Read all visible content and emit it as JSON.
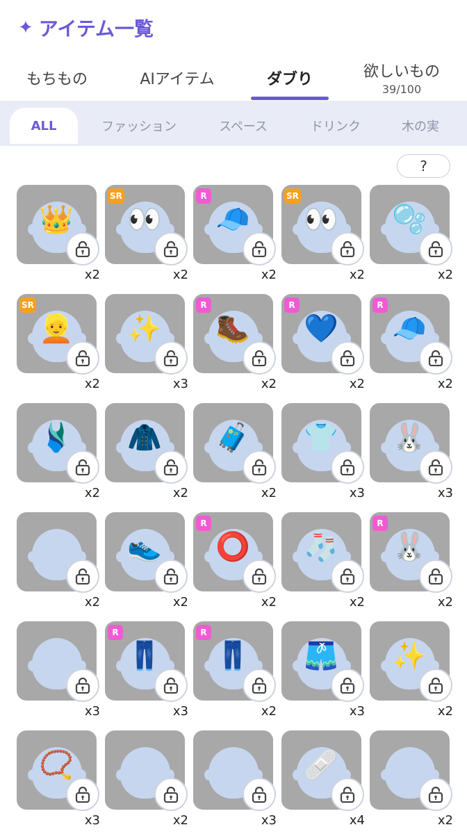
{
  "header": {
    "title_icon": "sparkle-icon",
    "title": "アイテム一覧",
    "accent_color": "#6a5ad8"
  },
  "tabs": [
    {
      "label": "もちもの",
      "active": false
    },
    {
      "label": "AIアイテム",
      "active": false
    },
    {
      "label": "ダブり",
      "active": true
    },
    {
      "label": "欲しいもの",
      "sub": "39/100",
      "active": false
    }
  ],
  "filters": [
    {
      "label": "ALL",
      "active": true
    },
    {
      "label": "ファッション",
      "active": false
    },
    {
      "label": "スペース",
      "active": false
    },
    {
      "label": "ドリンク",
      "active": false
    },
    {
      "label": "木の実",
      "active": false
    }
  ],
  "help_button": "?",
  "items": [
    {
      "badge": "",
      "count": "x2",
      "art": "👑"
    },
    {
      "badge": "SR",
      "count": "x2",
      "art": "👀"
    },
    {
      "badge": "R",
      "count": "x2",
      "art": "🧢"
    },
    {
      "badge": "SR",
      "count": "x2",
      "art": "👀"
    },
    {
      "badge": "",
      "count": "x2",
      "art": "🫧"
    },
    {
      "badge": "SR",
      "count": "x2",
      "art": "👱"
    },
    {
      "badge": "",
      "count": "x3",
      "art": "✨"
    },
    {
      "badge": "R",
      "count": "x2",
      "art": "🥾"
    },
    {
      "badge": "R",
      "count": "x2",
      "art": "💙"
    },
    {
      "badge": "R",
      "count": "x2",
      "art": "🧢"
    },
    {
      "badge": "",
      "count": "x2",
      "art": "🩱"
    },
    {
      "badge": "",
      "count": "x2",
      "art": "🧥"
    },
    {
      "badge": "",
      "count": "x2",
      "art": "🧳"
    },
    {
      "badge": "",
      "count": "x3",
      "art": "👕"
    },
    {
      "badge": "",
      "count": "x3",
      "art": "🐰"
    },
    {
      "badge": "",
      "count": "x2",
      "art": ""
    },
    {
      "badge": "",
      "count": "x2",
      "art": "👟"
    },
    {
      "badge": "R",
      "count": "x2",
      "art": "⭕"
    },
    {
      "badge": "",
      "count": "x2",
      "art": "🧦"
    },
    {
      "badge": "R",
      "count": "x2",
      "art": "🐰"
    },
    {
      "badge": "",
      "count": "x3",
      "art": ""
    },
    {
      "badge": "R",
      "count": "x3",
      "art": "👖"
    },
    {
      "badge": "R",
      "count": "x2",
      "art": "👖"
    },
    {
      "badge": "",
      "count": "x3",
      "art": "🩳"
    },
    {
      "badge": "",
      "count": "x2",
      "art": "✨"
    },
    {
      "badge": "",
      "count": "x3",
      "art": "📿"
    },
    {
      "badge": "",
      "count": "x2",
      "art": ""
    },
    {
      "badge": "",
      "count": "x3",
      "art": ""
    },
    {
      "badge": "",
      "count": "x4",
      "art": "🩹"
    },
    {
      "badge": "",
      "count": "x2",
      "art": ""
    }
  ]
}
